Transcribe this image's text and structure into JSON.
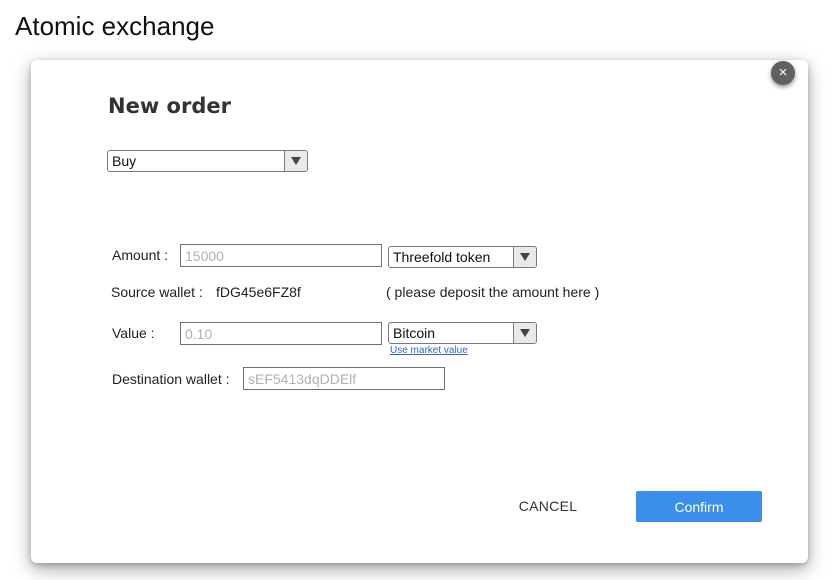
{
  "page": {
    "title": "Atomic exchange"
  },
  "dialog": {
    "title": "New order",
    "close_icon": "×",
    "order_type": {
      "selected": "Buy"
    },
    "amount": {
      "label": "Amount :",
      "placeholder": "15000",
      "token": "Threefold token"
    },
    "source_wallet": {
      "label": "Source wallet :",
      "value": "fDG45e6FZ8f",
      "note": "( please deposit the amount here )"
    },
    "value": {
      "label": "Value :",
      "placeholder": "0.10",
      "currency": "Bitcoin",
      "market_link": "Use market value"
    },
    "destination_wallet": {
      "label": "Destination wallet :",
      "placeholder": "sEF5413dqDDElf"
    },
    "buttons": {
      "cancel": "CANCEL",
      "confirm": "Confirm"
    }
  },
  "icons": {
    "close": "close-icon",
    "dropdown": "chevron-down-icon"
  },
  "colors": {
    "confirm_button": "#3b8eea",
    "close_button": "#616161",
    "link": "#3366cc"
  }
}
